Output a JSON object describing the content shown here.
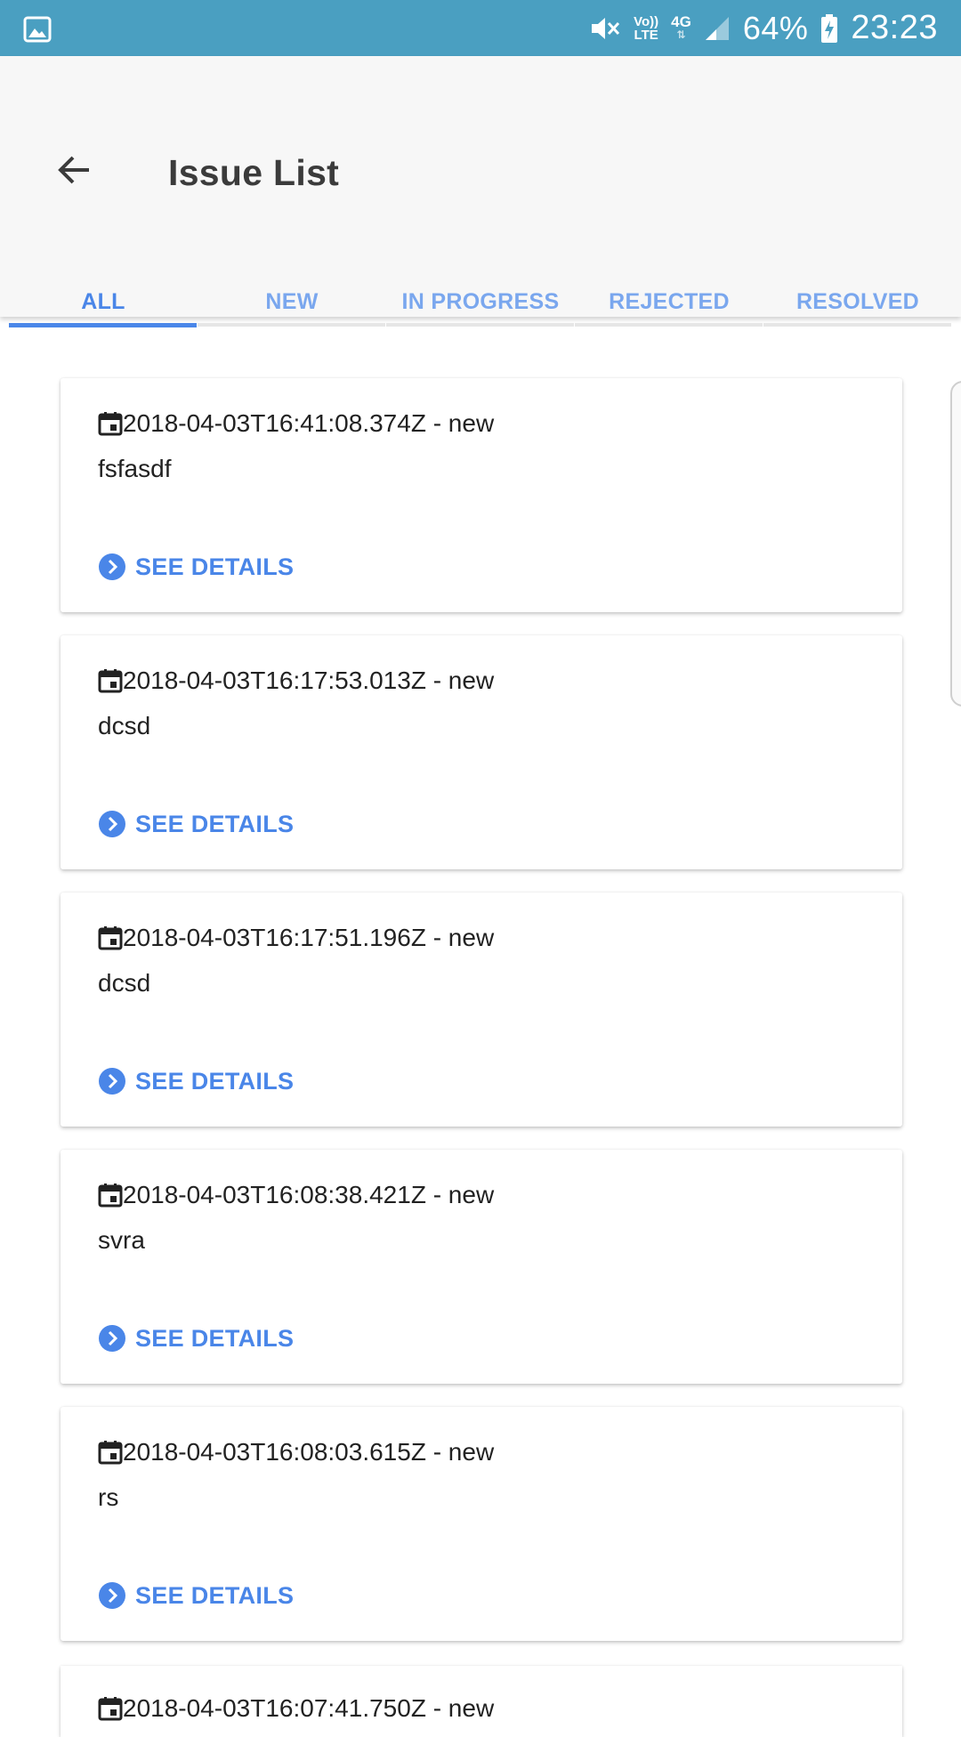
{
  "status_bar": {
    "volte_top": "Vo))",
    "volte_bottom": "LTE",
    "network": "4G",
    "battery": "64%",
    "time": "23:23"
  },
  "header": {
    "title": "Issue List"
  },
  "tabs": [
    {
      "label": "ALL",
      "active": true
    },
    {
      "label": "NEW",
      "active": false
    },
    {
      "label": "IN PROGRESS",
      "active": false
    },
    {
      "label": "REJECTED",
      "active": false
    },
    {
      "label": "RESOLVED",
      "active": false
    }
  ],
  "issues": [
    {
      "date": "2018-04-03T16:41:08.374Z - new",
      "title": "fsfasdf",
      "action": "SEE DETAILS"
    },
    {
      "date": "2018-04-03T16:17:53.013Z - new",
      "title": "dcsd",
      "action": "SEE DETAILS"
    },
    {
      "date": "2018-04-03T16:17:51.196Z - new",
      "title": "dcsd",
      "action": "SEE DETAILS"
    },
    {
      "date": "2018-04-03T16:08:38.421Z - new",
      "title": "svra",
      "action": "SEE DETAILS"
    },
    {
      "date": "2018-04-03T16:08:03.615Z - new",
      "title": "rs",
      "action": "SEE DETAILS"
    }
  ],
  "partial_issue": {
    "date": "2018-04-03T16:07:41.750Z - new"
  },
  "colors": {
    "status_bar": "#4a9fc1",
    "accent": "#4a86e8",
    "tab_inactive": "#7aa7ee",
    "app_bar": "#f7f7f7"
  },
  "icons": {
    "status_left": "gallery-icon",
    "back": "arrow-left-icon",
    "card_date": "calendar-icon",
    "card_action": "chevron-right-circle-icon"
  }
}
